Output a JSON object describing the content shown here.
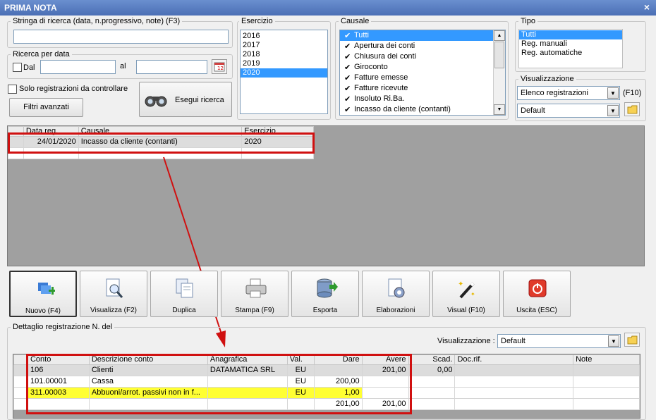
{
  "window": {
    "title": "PRIMA NOTA",
    "close": "×"
  },
  "search": {
    "legend": "Stringa di ricerca (data, n.progressivo, note) (F3)",
    "value": ""
  },
  "date_search": {
    "legend": "Ricerca per data",
    "from_label": "Dal",
    "to_label": "al",
    "from_value": "",
    "to_value": ""
  },
  "only_to_check": "Solo registrazioni da controllare",
  "advanced_filters": "Filtri avanzati",
  "run_search": "Esegui ricerca",
  "exercise": {
    "legend": "Esercizio",
    "items": [
      "2016",
      "2017",
      "2018",
      "2019",
      "2020"
    ],
    "selected": "2020"
  },
  "causale": {
    "legend": "Causale",
    "items": [
      {
        "label": "Tutti",
        "checked": true,
        "selected": true
      },
      {
        "label": "Apertura dei conti",
        "checked": true
      },
      {
        "label": "Chiusura dei conti",
        "checked": true
      },
      {
        "label": "Giroconto",
        "checked": true
      },
      {
        "label": "Fatture emesse",
        "checked": true
      },
      {
        "label": "Fatture ricevute",
        "checked": true
      },
      {
        "label": "Insoluto Ri.Ba.",
        "checked": true
      },
      {
        "label": "Incasso da cliente (contanti)",
        "checked": true
      }
    ]
  },
  "tipo": {
    "legend": "Tipo",
    "items": [
      "Tutti",
      "Reg. manuali",
      "Reg. automatiche"
    ],
    "selected": "Tutti"
  },
  "visualization": {
    "legend": "Visualizzazione",
    "combo1": "Elenco registrazioni",
    "hotkey": "(F10)",
    "combo2": "Default"
  },
  "reg_grid": {
    "headers": [
      "Data reg.",
      "Causale",
      "Esercizio"
    ],
    "rows": [
      {
        "date": "24/01/2020",
        "causale": "Incasso da cliente (contanti)",
        "esercizio": "2020"
      }
    ]
  },
  "toolbar": [
    {
      "label": "Nuovo (F4)",
      "icon": "new-icon"
    },
    {
      "label": "Visualizza (F2)",
      "icon": "view-icon"
    },
    {
      "label": "Duplica",
      "icon": "duplicate-icon"
    },
    {
      "label": "Stampa (F9)",
      "icon": "print-icon"
    },
    {
      "label": "Esporta",
      "icon": "export-icon"
    },
    {
      "label": "Elaborazioni",
      "icon": "process-icon"
    },
    {
      "label": "Visual (F10)",
      "icon": "wand-icon"
    },
    {
      "label": "Uscita (ESC)",
      "icon": "exit-icon"
    }
  ],
  "detail": {
    "legend": "Dettaglio registrazione N.  del",
    "vis_label": "Visualizzazione :",
    "vis_value": "Default",
    "headers": [
      "Conto",
      "Descrizione conto",
      "Anagrafica",
      "Val.",
      "Dare",
      "Avere",
      "Scad.",
      "Doc.rif.",
      "Note"
    ],
    "rows": [
      {
        "conto": "106",
        "descr": "Clienti",
        "anag": "DATAMATICA SRL",
        "val": "EU",
        "dare": "",
        "avere": "201,00",
        "scad": "0,00",
        "doc": "",
        "note": "",
        "style": "gray"
      },
      {
        "conto": "101.00001",
        "descr": "Cassa",
        "anag": "",
        "val": "EU",
        "dare": "200,00",
        "avere": "",
        "scad": "",
        "doc": "",
        "note": "",
        "style": "white"
      },
      {
        "conto": "311.00003",
        "descr": "Abbuoni/arrot. passivi non in f...",
        "anag": "",
        "val": "EU",
        "dare": "1,00",
        "avere": "",
        "scad": "",
        "doc": "",
        "note": "",
        "style": "yellow"
      }
    ],
    "totals": {
      "dare": "201,00",
      "avere": "201,00"
    }
  },
  "colors": {
    "selection": "#3399ff",
    "highlight_row": "#ffff33",
    "annotation": "#d01010"
  }
}
